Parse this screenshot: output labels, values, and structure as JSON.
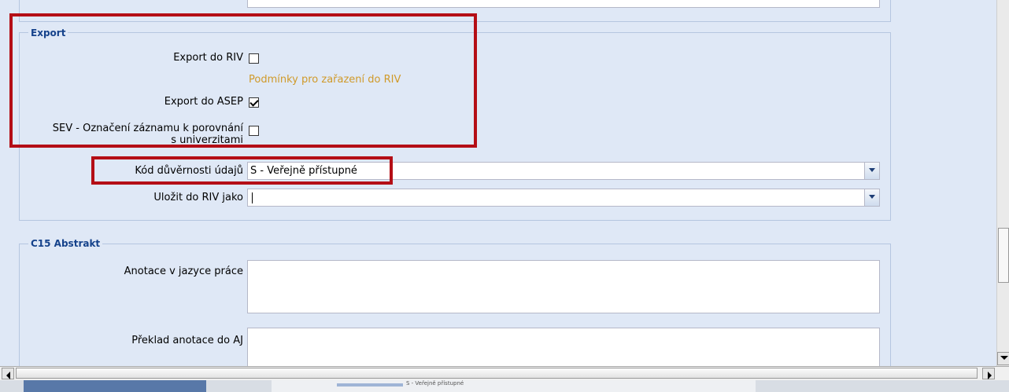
{
  "export_section": {
    "legend": "Export",
    "export_riv_label": "Export do RIV",
    "export_riv_checked": false,
    "riv_conditions_link": "Podmínky pro zařazení do RIV",
    "export_asep_label": "Export do ASEP",
    "export_asep_checked": true,
    "sev_label_line1": "SEV - Označení záznamu k porovnání",
    "sev_label_line2": "s univerzitami",
    "sev_checked": false,
    "confidentiality_label": "Kód důvěrnosti údajů",
    "confidentiality_value": "S - Veřejně přístupné",
    "save_riv_label": "Uložit do RIV jako",
    "save_riv_value": ""
  },
  "abstract_section": {
    "legend": "C15 Abstrakt",
    "annotation_label": "Anotace v jazyce práce",
    "annotation_value": "",
    "translation_label": "Překlad anotace do AJ",
    "translation_value": ""
  },
  "background_strip_text": "S - Veřejně přístupné",
  "colors": {
    "highlight": "#b40e16",
    "link": "#d09a2a",
    "legend": "#15428b"
  },
  "icons": [
    "chevron-down-icon",
    "scroll-left-icon",
    "scroll-right-icon",
    "scroll-down-icon"
  ]
}
